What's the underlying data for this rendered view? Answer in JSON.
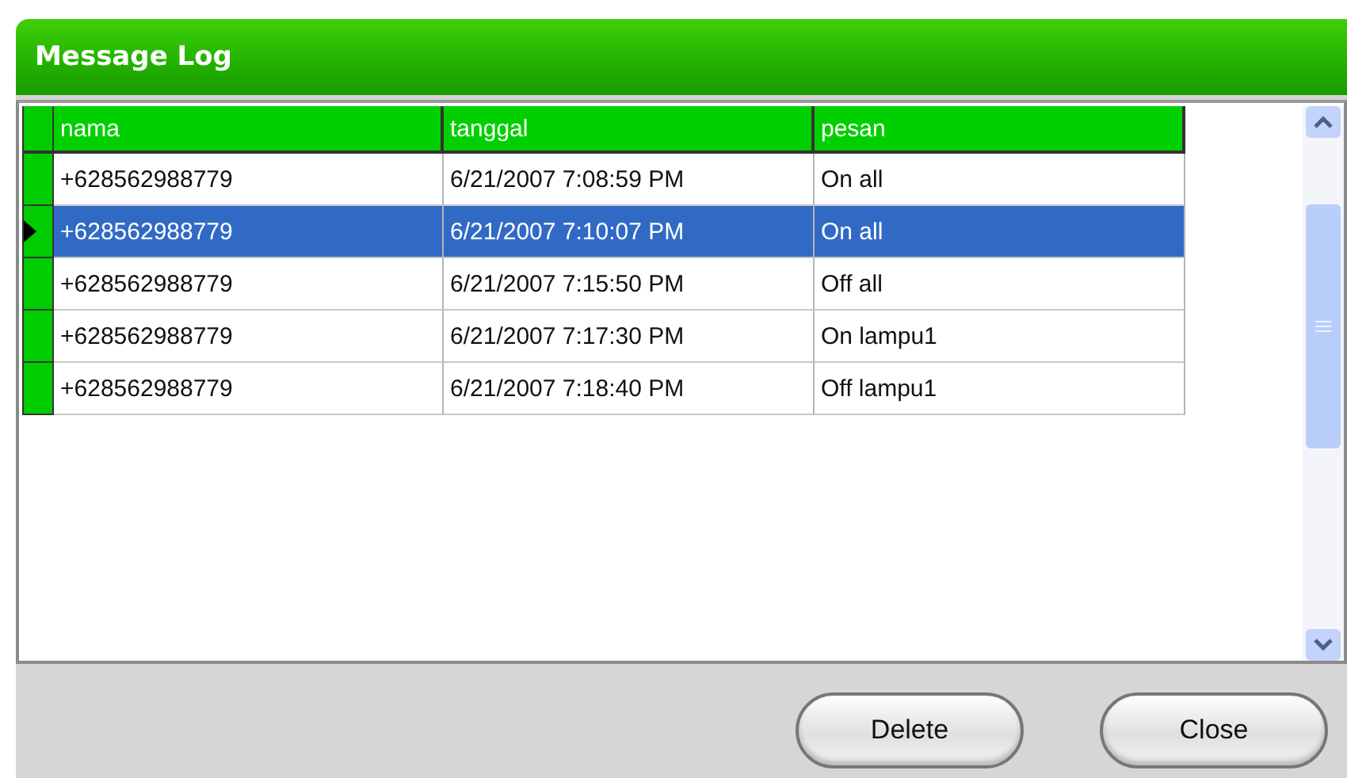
{
  "window": {
    "title": "Message Log"
  },
  "table": {
    "columns": [
      "nama",
      "tanggal",
      "pesan"
    ],
    "rows": [
      {
        "cells": [
          "+628562988779",
          "6/21/2007 7:08:59 PM",
          "On all"
        ],
        "selected": false
      },
      {
        "cells": [
          "+628562988779",
          "6/21/2007 7:10:07 PM",
          "On all"
        ],
        "selected": true
      },
      {
        "cells": [
          "+628562988779",
          "6/21/2007 7:15:50 PM",
          "Off all"
        ],
        "selected": false
      },
      {
        "cells": [
          "+628562988779",
          "6/21/2007 7:17:30 PM",
          "On lampu1"
        ],
        "selected": false
      },
      {
        "cells": [
          "+628562988779",
          "6/21/2007 7:18:40 PM",
          "Off lampu1"
        ],
        "selected": false
      }
    ]
  },
  "buttons": [
    "Delete",
    "Close"
  ]
}
